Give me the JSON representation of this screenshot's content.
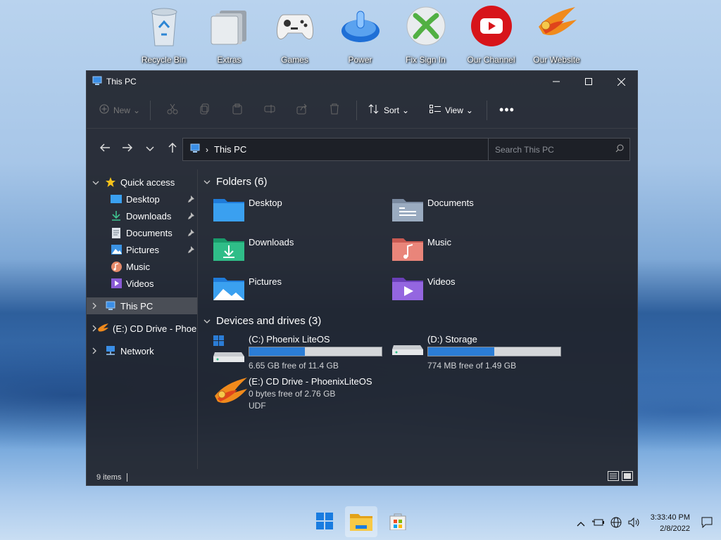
{
  "desktop": {
    "icons": [
      {
        "label": "Recycle Bin",
        "icon": "recycle-bin-icon"
      },
      {
        "label": "Extras",
        "icon": "extras-folder-icon"
      },
      {
        "label": "Games",
        "icon": "gamepad-icon"
      },
      {
        "label": "Power",
        "icon": "power-icon"
      },
      {
        "label": "Fix Sign In",
        "icon": "xbox-icon"
      },
      {
        "label": "Our Channel",
        "icon": "youtube-icon"
      },
      {
        "label": "Our Website",
        "icon": "phoenix-icon"
      }
    ]
  },
  "window": {
    "title": "This PC",
    "toolbar": {
      "new_label": "New",
      "sort_label": "Sort",
      "view_label": "View"
    },
    "address": {
      "path": "This PC"
    },
    "search": {
      "placeholder": "Search This PC"
    },
    "sidebar": {
      "quick_access": "Quick access",
      "quick_items": [
        {
          "label": "Desktop",
          "pinned": true
        },
        {
          "label": "Downloads",
          "pinned": true
        },
        {
          "label": "Documents",
          "pinned": true
        },
        {
          "label": "Pictures",
          "pinned": true
        },
        {
          "label": "Music",
          "pinned": false
        },
        {
          "label": "Videos",
          "pinned": false
        }
      ],
      "this_pc": "This PC",
      "cd_drive": "(E:) CD Drive - PhoenixLiteOS",
      "network": "Network"
    },
    "folders_header": "Folders (6)",
    "folders": [
      {
        "name": "Desktop"
      },
      {
        "name": "Documents"
      },
      {
        "name": "Downloads"
      },
      {
        "name": "Music"
      },
      {
        "name": "Pictures"
      },
      {
        "name": "Videos"
      }
    ],
    "drives_header": "Devices and drives (3)",
    "drives": [
      {
        "name": "(C:) Phoenix LiteOS",
        "free": "6.65 GB free of 11.4 GB",
        "used_fraction": 0.42
      },
      {
        "name": "(D:) Storage",
        "free": "774 MB free of 1.49 GB",
        "used_fraction": 0.5
      }
    ],
    "cd": {
      "name": "(E:) CD Drive - PhoenixLiteOS",
      "free": "0 bytes free of 2.76 GB",
      "fs": "UDF"
    },
    "status": {
      "items": "9 items"
    }
  },
  "taskbar": {
    "time": "3:33:40 PM",
    "date": "2/8/2022"
  }
}
